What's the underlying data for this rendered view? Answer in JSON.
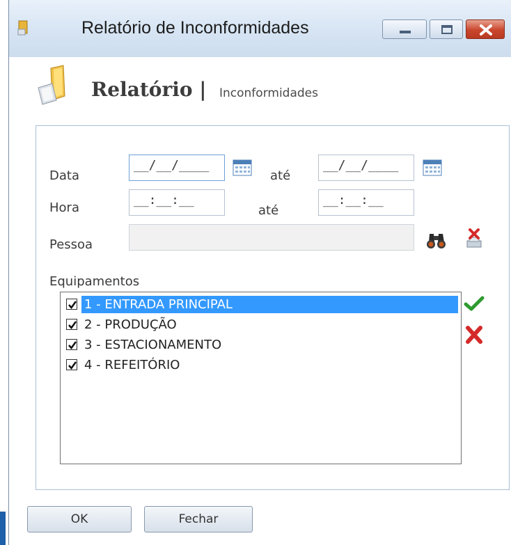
{
  "window": {
    "title": "Relatório de Inconformidades",
    "controls": [
      "minimize",
      "maximize",
      "close"
    ]
  },
  "header": {
    "title": "Relatório |",
    "subtitle": "Inconformidades"
  },
  "form": {
    "data_label": "Data",
    "data_from": "__/__/____",
    "ate_label_1": "até",
    "data_to": "__/__/____",
    "hora_label": "Hora",
    "hora_from": "__:__:__",
    "ate_label_2": "até",
    "hora_to": "__:__:__",
    "pessoa_label": "Pessoa",
    "pessoa_value": "",
    "equipamentos_label": "Equipamentos",
    "equipamentos": [
      {
        "label": "1 - ENTRADA PRINCIPAL",
        "checked": true,
        "selected": true
      },
      {
        "label": "2 - PRODUÇÃO",
        "checked": true,
        "selected": false
      },
      {
        "label": "3 - ESTACIONAMENTO",
        "checked": true,
        "selected": false
      },
      {
        "label": "4 - REFEITÓRIO",
        "checked": true,
        "selected": false
      }
    ]
  },
  "buttons": {
    "ok": "OK",
    "fechar": "Fechar"
  },
  "icons": {
    "calendar": "calendar-icon",
    "search": "binoculars-icon",
    "clear": "clear-person-icon",
    "select_all": "checkmark-icon",
    "deselect_all": "red-x-icon"
  },
  "colors": {
    "selection": "#3399ff",
    "accent_green": "#2e9b2e",
    "accent_red": "#d42a2a"
  }
}
